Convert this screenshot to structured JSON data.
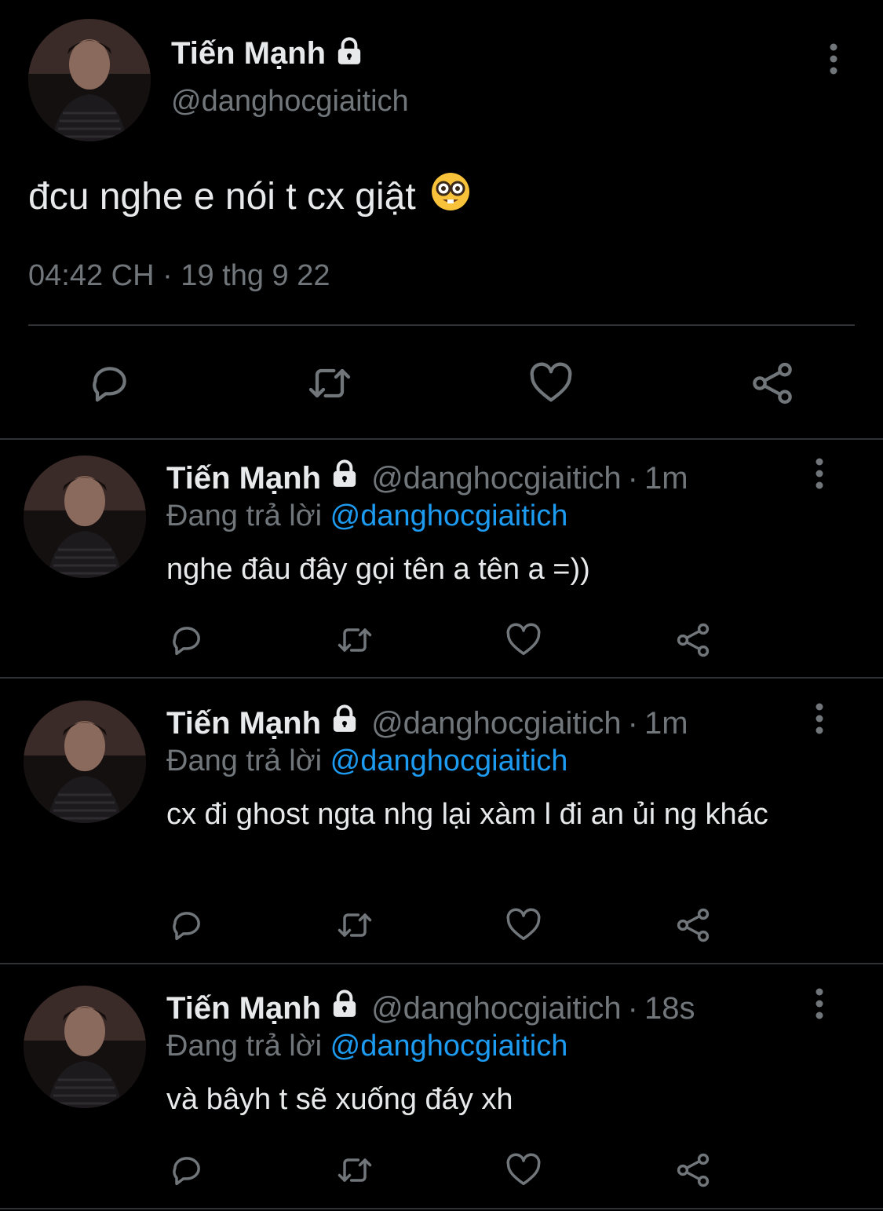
{
  "main_tweet": {
    "name": "Tiến Mạnh",
    "handle": "@danghocgiaitich",
    "text": "đcu nghe e nói t cx giật",
    "emoji_icon": "nerd-face-emoji",
    "timestamp": "04:42 CH · 19 thg 9 22"
  },
  "replies": [
    {
      "name": "Tiến Mạnh",
      "handle": "@danghocgiaitich",
      "separator": "·",
      "ago": "1m",
      "replying_prefix": "Đang trả lời",
      "replying_to": "@danghocgiaitich",
      "text": "nghe đâu đây gọi tên a tên a =))"
    },
    {
      "name": "Tiến Mạnh",
      "handle": "@danghocgiaitich",
      "separator": "·",
      "ago": "1m",
      "replying_prefix": "Đang trả lời",
      "replying_to": "@danghocgiaitich",
      "text": "cx đi ghost ngta nhg lại xàm l đi an ủi ng khác"
    },
    {
      "name": "Tiến Mạnh",
      "handle": "@danghocgiaitich",
      "separator": "·",
      "ago": "18s",
      "replying_prefix": "Đang trả lời",
      "replying_to": "@danghocgiaitich",
      "text": "và bâyh t sẽ xuống đáy xh"
    }
  ],
  "icons": [
    "lock-icon",
    "more-vertical-icon",
    "reply-icon",
    "retweet-icon",
    "like-icon",
    "share-icon"
  ],
  "colors": {
    "background": "#000000",
    "text": "#e7e9ea",
    "muted": "#71767b",
    "link": "#1d9bf0",
    "divider": "#2f3336"
  }
}
